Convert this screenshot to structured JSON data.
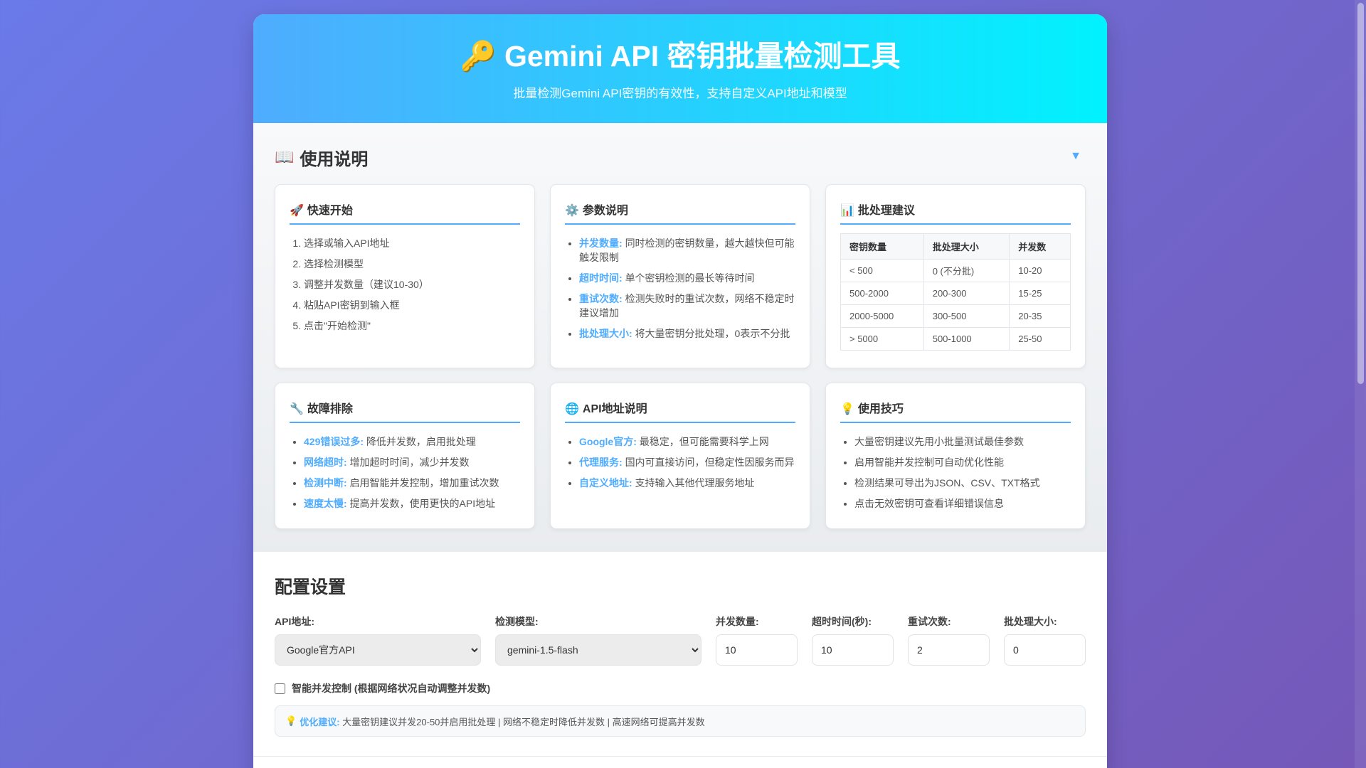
{
  "header": {
    "icon": "key-icon",
    "title": "Gemini API 密钥批量检测工具",
    "subtitle": "批量检测Gemini API密钥的有效性，支持自定义API地址和模型"
  },
  "instructions": {
    "title": "使用说明",
    "toggle": "▼",
    "quick_start": {
      "title": "快速开始",
      "steps": [
        "选择或输入API地址",
        "选择检测模型",
        "调整并发数量（建议10-30）",
        "粘贴API密钥到输入框",
        "点击\"开始检测\""
      ]
    },
    "params": {
      "title": "参数说明",
      "items": [
        {
          "key": "并发数量:",
          "text": "同时检测的密钥数量，越大越快但可能触发限制"
        },
        {
          "key": "超时时间:",
          "text": "单个密钥检测的最长等待时间"
        },
        {
          "key": "重试次数:",
          "text": "检测失败时的重试次数，网络不稳定时建议增加"
        },
        {
          "key": "批处理大小:",
          "text": "将大量密钥分批处理，0表示不分批"
        }
      ]
    },
    "batch": {
      "title": "批处理建议",
      "headers": [
        "密钥数量",
        "批处理大小",
        "并发数"
      ],
      "rows": [
        [
          "< 500",
          "0 (不分批)",
          "10-20"
        ],
        [
          "500-2000",
          "200-300",
          "15-25"
        ],
        [
          "2000-5000",
          "300-500",
          "20-35"
        ],
        [
          "> 5000",
          "500-1000",
          "25-50"
        ]
      ]
    },
    "troubleshoot": {
      "title": "故障排除",
      "items": [
        {
          "key": "429错误过多:",
          "text": "降低并发数，启用批处理"
        },
        {
          "key": "网络超时:",
          "text": "增加超时时间，减少并发数"
        },
        {
          "key": "检测中断:",
          "text": "启用智能并发控制，增加重试次数"
        },
        {
          "key": "速度太慢:",
          "text": "提高并发数，使用更快的API地址"
        }
      ]
    },
    "api": {
      "title": "API地址说明",
      "items": [
        {
          "key": "Google官方:",
          "text": "最稳定，但可能需要科学上网"
        },
        {
          "key": "代理服务:",
          "text": "国内可直接访问，但稳定性因服务而异"
        },
        {
          "key": "自定义地址:",
          "text": "支持输入其他代理服务地址"
        }
      ]
    },
    "tips": {
      "title": "使用技巧",
      "items": [
        "大量密钥建议先用小批量测试最佳参数",
        "启用智能并发控制可自动优化性能",
        "检测结果可导出为JSON、CSV、TXT格式",
        "点击无效密钥可查看详细错误信息"
      ]
    }
  },
  "config": {
    "title": "配置设置",
    "api_label": "API地址:",
    "api_value": "Google官方API",
    "model_label": "检测模型:",
    "model_value": "gemini-1.5-flash",
    "concurrency_label": "并发数量:",
    "concurrency_value": "10",
    "timeout_label": "超时时间(秒):",
    "timeout_value": "10",
    "retry_label": "重试次数:",
    "retry_value": "2",
    "batch_label": "批处理大小:",
    "batch_value": "0",
    "smart_label": "智能并发控制 (根据网络状况自动调整并发数)",
    "smart_checked": false,
    "tip_key": "优化建议:",
    "tip_text": "大量密钥建议并发20-50并启用批处理 | 网络不稳定时降低并发数 | 高速网络可提高并发数"
  }
}
